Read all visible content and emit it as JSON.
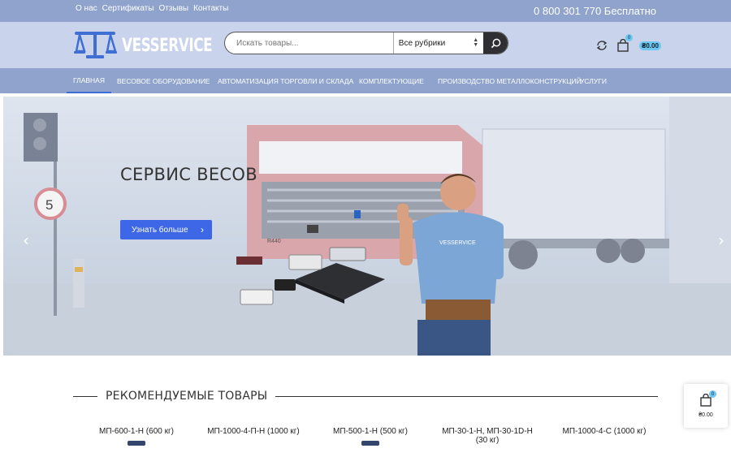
{
  "topbar": {
    "links": [
      "О нас",
      "Сертификаты",
      "Отзывы",
      "Контакты"
    ],
    "phone": "0 800 301 770 Бесплатно"
  },
  "logo": {
    "text": "VESSERVICE"
  },
  "search": {
    "placeholder": "Искать товары...",
    "category": "Все рубрики"
  },
  "header": {
    "cart_count": "0",
    "cart_total": "₴0.00"
  },
  "nav": {
    "items": [
      "Главная",
      "Весовое оборудование",
      "Автоматизация торговли и склада",
      "Комплектующие",
      "Производство металлоконструкций",
      "Услуги"
    ]
  },
  "hero": {
    "title": "СЕРВИС ВЕСОВ",
    "button": "Узнать больше",
    "speed_sign": "5",
    "shirt_text": "VESSERVICE",
    "truck_plate": "R440"
  },
  "featured": {
    "title": "Рекомендуемые товары",
    "products": [
      "МП-600-1-Н (600 кг)",
      "МП-1000-4-П-Н (1000 кг)",
      "МП-500-1-Н (500 кг)",
      "МП-30-1-Н, МП-30-1D-Н (30 кг)",
      "МП-1000-4-С (1000 кг)"
    ]
  },
  "mini_cart": {
    "count": "0",
    "total": "₴0.00"
  },
  "colors": {
    "topbar": "#8fa3cc",
    "header": "#c9d3ec",
    "accent": "#3d67e6",
    "badge": "#6ec7ee"
  }
}
